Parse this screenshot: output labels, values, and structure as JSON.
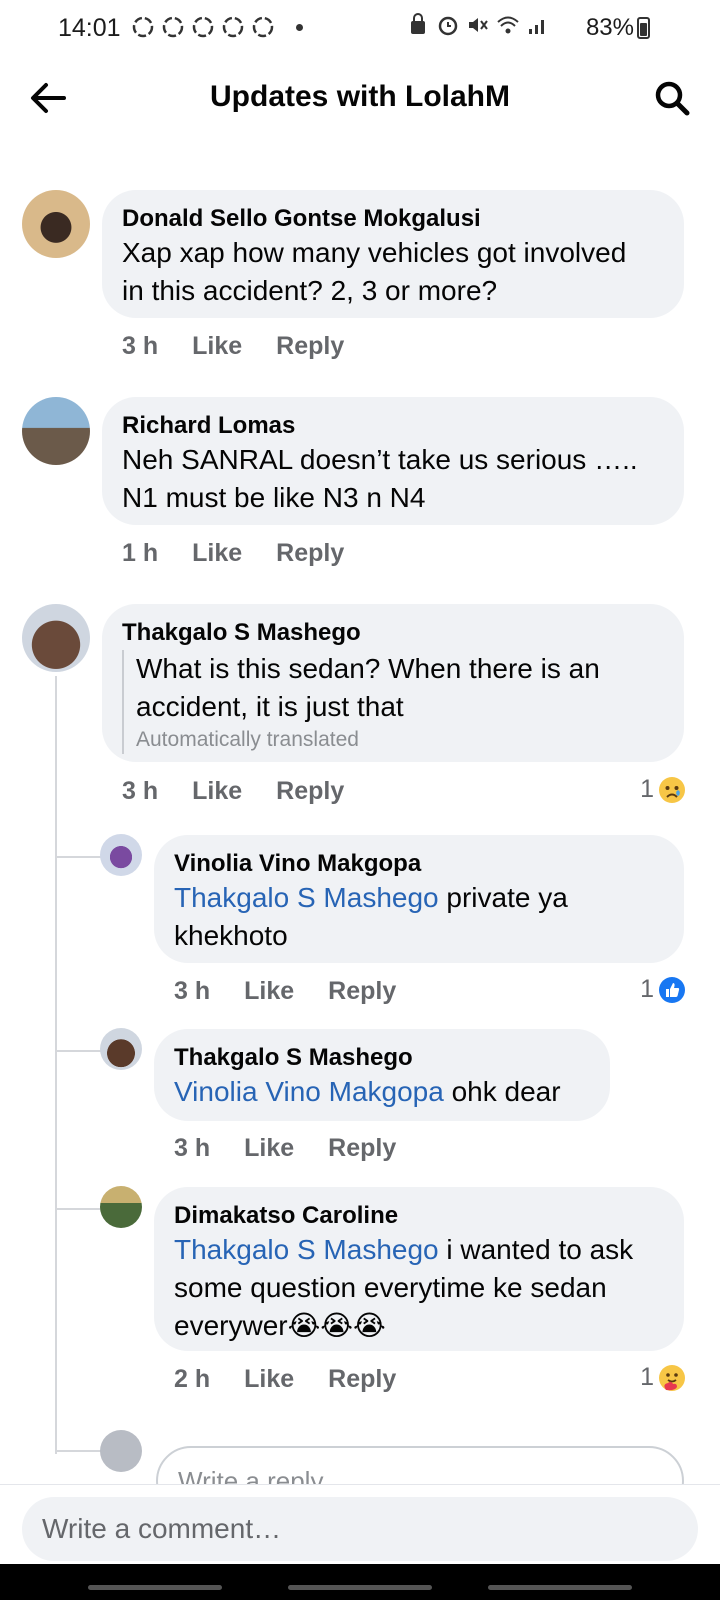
{
  "status_bar": {
    "time": "14:01",
    "battery": "83%",
    "icons": [
      "notification-ring-icon",
      "alarm-icon",
      "mute-icon",
      "wifi-icon",
      "signal-icon",
      "battery-icon"
    ]
  },
  "header": {
    "title": "Updates with LolahM",
    "back_icon": "back-arrow-icon",
    "search_icon": "search-icon"
  },
  "comments": [
    {
      "author": "Donald Sello Gontse Mokgalusi",
      "text_lines": [
        "Xap xap how many vehicles got involved",
        "in this accident? 2, 3 or more?"
      ],
      "time": "3 h",
      "like": "Like",
      "reply": "Reply"
    },
    {
      "author": "Richard Lomas",
      "text_lines": [
        "Neh SANRAL doesn’t take us serious …..",
        "N1 must be like N3 n N4"
      ],
      "time": "1 h",
      "like": "Like",
      "reply": "Reply"
    },
    {
      "author": "Thakgalo S Mashego",
      "text_lines": [
        "What is this sedan? When there is an",
        "accident, it is just that"
      ],
      "translated_note": "Automatically translated",
      "time": "3 h",
      "like": "Like",
      "reply": "Reply",
      "reaction_count": "1",
      "reaction_icon": "sad-reaction-icon"
    }
  ],
  "replies": [
    {
      "author": "Vinolia Vino Makgopa",
      "mention": "Thakgalo S Mashego",
      "text_after": " private ya",
      "text_line2": "khekhoto",
      "time": "3 h",
      "like": "Like",
      "reply": "Reply",
      "reaction_count": "1",
      "reaction_icon": "like-reaction-icon"
    },
    {
      "author": "Thakgalo S Mashego",
      "mention": "Vinolia Vino Makgopa",
      "text_after": " ohk dear",
      "time": "3 h",
      "like": "Like",
      "reply": "Reply"
    },
    {
      "author": "Dimakatso Caroline",
      "mention": "Thakgalo S Mashego",
      "text_after": " i wanted to ask",
      "text_line2": "some question everytime ke sedan",
      "text_line3": "everywer😭😭😭",
      "time": "2 h",
      "like": "Like",
      "reply": "Reply",
      "reaction_count": "1",
      "reaction_icon": "care-reaction-icon"
    }
  ],
  "reply_input": {
    "placeholder": "Write a reply..."
  },
  "comment_input": {
    "placeholder": "Write a comment…"
  },
  "colors": {
    "bubble": "#f0f2f5",
    "mention": "#2764b5",
    "meta": "#65676b",
    "like_blue": "#1877f2"
  }
}
